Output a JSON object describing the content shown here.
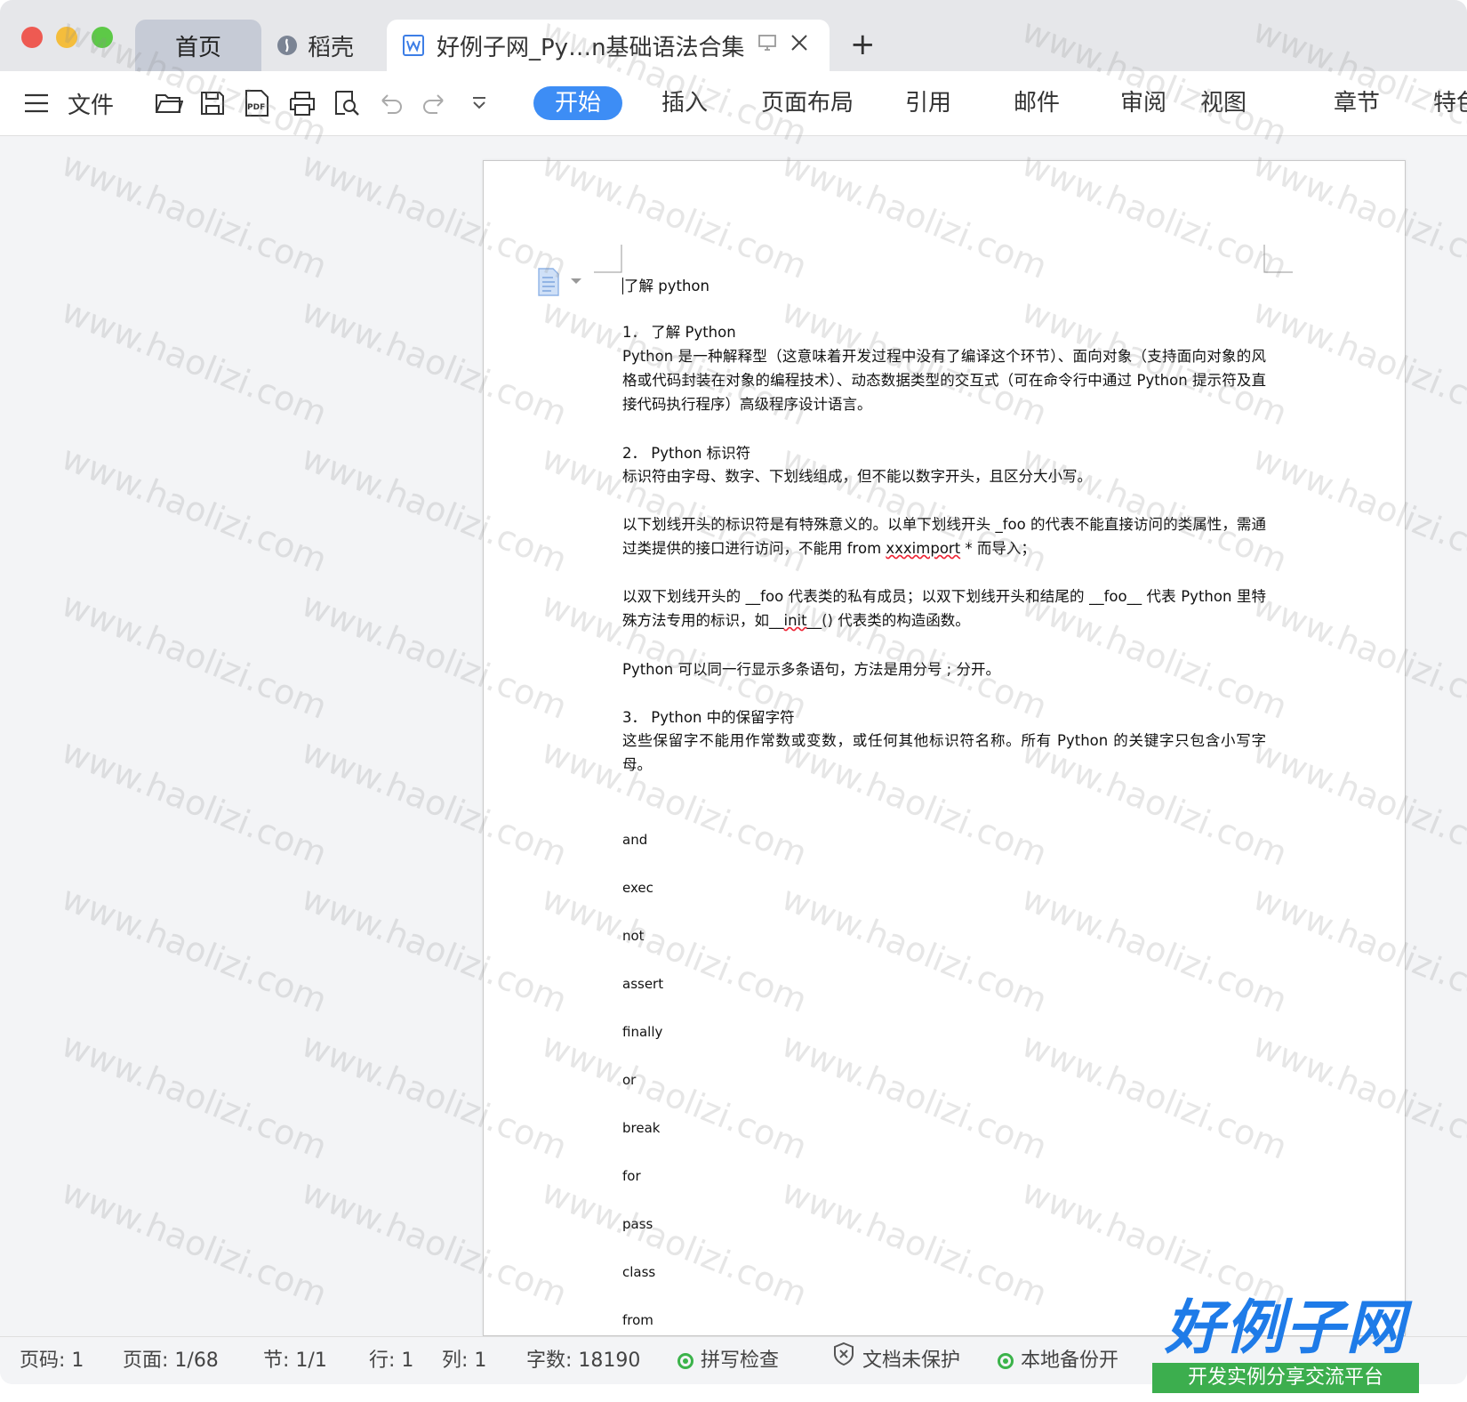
{
  "tabs": {
    "home": "首页",
    "daoke": "稻壳",
    "doc_title": "好例子网_Py…n基础语法合集"
  },
  "toolbar": {
    "file": "文件",
    "menu": [
      "开始",
      "插入",
      "页面布局",
      "引用",
      "邮件",
      "审阅",
      "视图",
      "章节",
      "特色"
    ]
  },
  "doc": {
    "title": "了解 python",
    "s1_head": "1．  了解 Python",
    "s1_body": "Python 是一种解释型（这意味着开发过程中没有了编译这个环节）、面向对象（支持面向对象的风格或代码封装在对象的编程技术）、动态数据类型的交互式（可在命令行中通过 Python 提示符及直接代码执行程序）高级程序设计语言。",
    "s2_head": "2．  Python 标识符",
    "s2_body": "标识符由字母、数字、下划线组成，但不能以数字开头，且区分大小写。",
    "p_single_a": "以下划线开头的标识符是有特殊意义的。以单下划线开头 _foo 的代表不能直接访问的类属性，需通过类提供的接口进行访问，不能用 from ",
    "p_single_b": "xxximport",
    "p_single_c": " * 而导入；",
    "p_double_a": "以双下划线开头的 __foo 代表类的私有成员；以双下划线开头和结尾的 __foo__ 代表 Python 里特殊方法专用的标识，如__",
    "p_double_b": "init",
    "p_double_c": "__() 代表类的构造函数。",
    "p_semicolon": "Python 可以同一行显示多条语句，方法是用分号 ; 分开。",
    "s3_head": "3．  Python 中的保留字符",
    "s3_body": "这些保留字不能用作常数或变数，或任何其他标识符名称。所有 Python 的关键字只包含小写字母。",
    "keywords": [
      "and",
      "exec",
      "not",
      "assert",
      "finally",
      "or",
      "break",
      "for",
      "pass",
      "class",
      "from"
    ]
  },
  "status": {
    "page_no": "页码: 1",
    "pages": "页面: 1/68",
    "section": "节: 1/1",
    "row": "行: 1",
    "col": "列: 1",
    "words": "字数: 18190",
    "spell": "拼写检查",
    "protect": "文档未保护",
    "backup": "本地备份开"
  },
  "watermark": "www.haolizi.com",
  "logo": {
    "main": "好例子网",
    "sub": "开发实例分享交流平台"
  },
  "colors": {
    "accent": "#3d8df5",
    "logo_blue": "#1e7be8",
    "logo_green": "#3cae4e"
  }
}
